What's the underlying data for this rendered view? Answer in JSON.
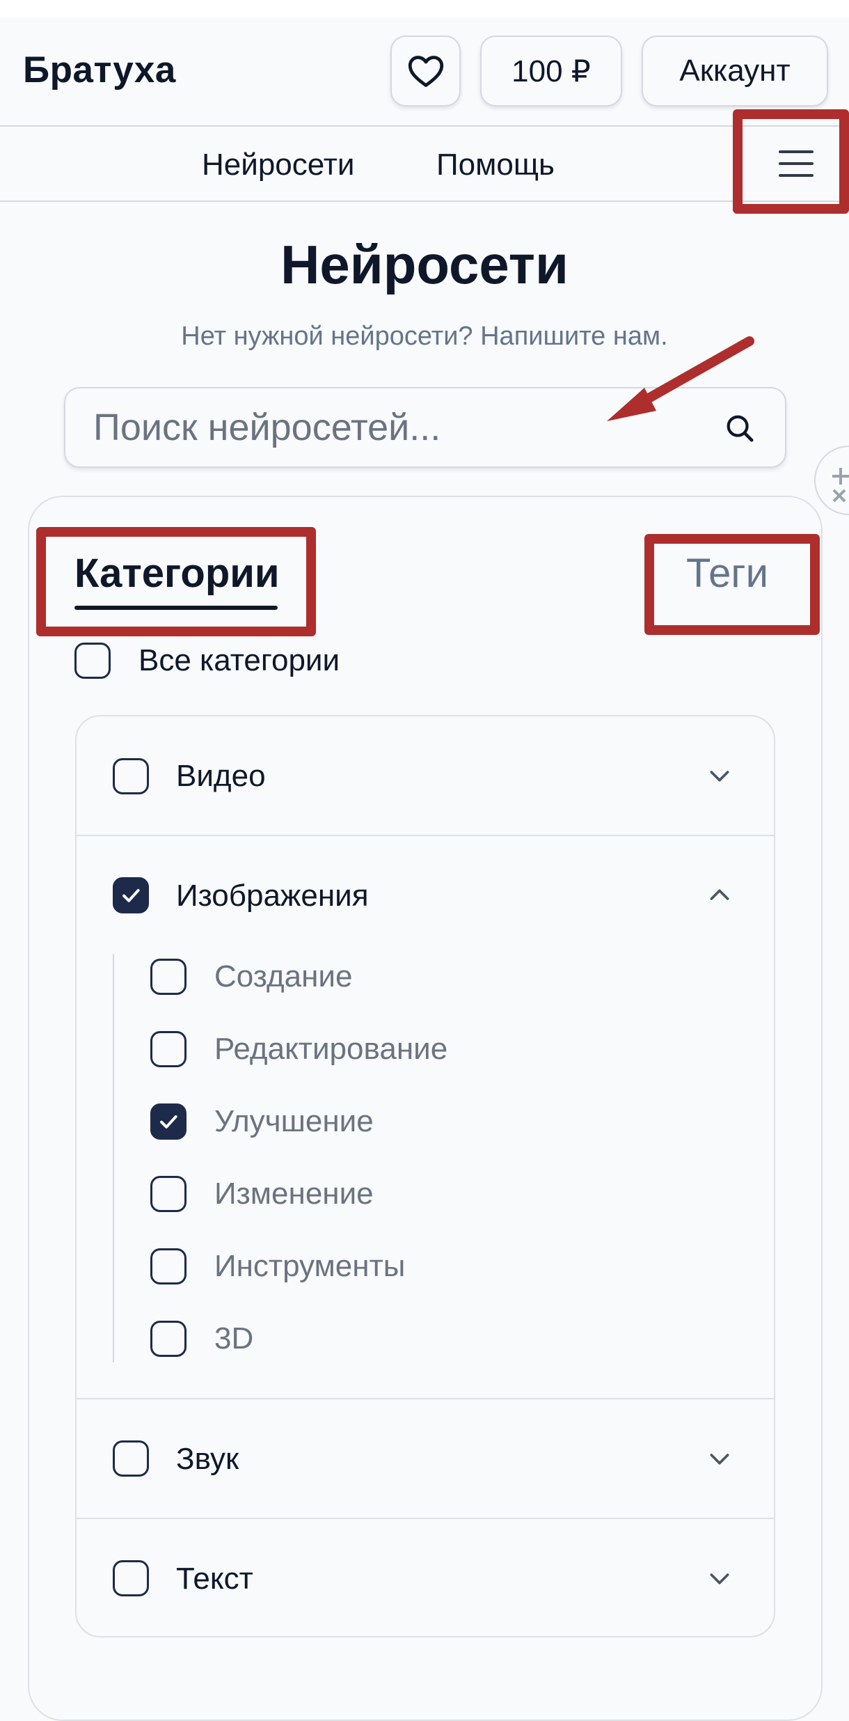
{
  "header": {
    "logo": "Братуха",
    "balance_label": "100 ₽",
    "account_label": "Аккаунт"
  },
  "nav": {
    "items": [
      {
        "label": "Нейросети"
      },
      {
        "label": "Помощь"
      }
    ]
  },
  "page": {
    "title": "Нейросети",
    "subtitle": "Нет нужной нейросети? Напишите нам."
  },
  "search": {
    "placeholder": "Поиск нейросетей...",
    "value": ""
  },
  "filters": {
    "tabs": [
      {
        "label": "Категории",
        "active": true
      },
      {
        "label": "Теги",
        "active": false
      }
    ],
    "all_label": "Все категории",
    "categories": [
      {
        "label": "Видео",
        "checked": false,
        "expanded": false
      },
      {
        "label": "Изображения",
        "checked": true,
        "expanded": true,
        "subcategories": [
          {
            "label": "Создание",
            "checked": false
          },
          {
            "label": "Редактирование",
            "checked": false
          },
          {
            "label": "Улучшение",
            "checked": true
          },
          {
            "label": "Изменение",
            "checked": false
          },
          {
            "label": "Инструменты",
            "checked": false
          },
          {
            "label": "3D",
            "checked": false
          }
        ]
      },
      {
        "label": "Звук",
        "checked": false,
        "expanded": false
      },
      {
        "label": "Текст",
        "checked": false,
        "expanded": false
      }
    ]
  },
  "colors": {
    "background": "#f8fafc",
    "text": "#0f172a",
    "muted": "#64748b",
    "checkbox_fill": "#1e2a4a",
    "annotation_red": "#ad2e2c"
  },
  "icons": [
    "heart-icon",
    "menu-icon",
    "search-icon",
    "check-icon",
    "chevron-down-icon",
    "chevron-up-icon"
  ]
}
